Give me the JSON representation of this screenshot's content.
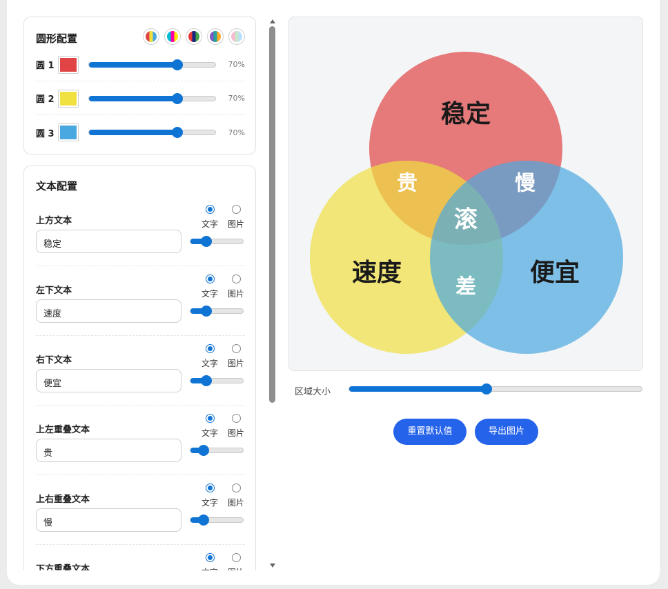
{
  "circle_config": {
    "title": "圆形配置",
    "presets": [
      {
        "name": "preset-1",
        "colors": [
          "#e04444",
          "#f0e040",
          "#4aa8e0"
        ]
      },
      {
        "name": "preset-2",
        "colors": [
          "#00bcd4",
          "#ff00aa",
          "#ffe600"
        ]
      },
      {
        "name": "preset-3",
        "colors": [
          "#e53935",
          "#1a237e",
          "#43a047"
        ]
      },
      {
        "name": "preset-4",
        "colors": [
          "#7e57c2",
          "#26a69a",
          "#ffa726"
        ]
      },
      {
        "name": "preset-5",
        "colors": [
          "#f8bbd0",
          "#c8e6c9",
          "#bbdefb"
        ]
      }
    ],
    "circles": [
      {
        "label": "圆 1",
        "color": "#e04444",
        "opacity": 0.7,
        "opacity_text": "70%"
      },
      {
        "label": "圆 2",
        "color": "#f0e040",
        "opacity": 0.7,
        "opacity_text": "70%"
      },
      {
        "label": "圆 3",
        "color": "#4aa8e0",
        "opacity": 0.7,
        "opacity_text": "70%"
      }
    ]
  },
  "text_config": {
    "title": "文本配置",
    "option_text": "文字",
    "option_image": "图片",
    "rows": [
      {
        "label": "上方文本",
        "value": "稳定",
        "mode": "text",
        "size_level": 0.3
      },
      {
        "label": "左下文本",
        "value": "速度",
        "mode": "text",
        "size_level": 0.3
      },
      {
        "label": "右下文本",
        "value": "便宜",
        "mode": "text",
        "size_level": 0.3
      },
      {
        "label": "上左重叠文本",
        "value": "贵",
        "mode": "text",
        "size_level": 0.25
      },
      {
        "label": "上右重叠文本",
        "value": "慢",
        "mode": "text",
        "size_level": 0.25
      },
      {
        "label": "下方重叠文本",
        "value": "差",
        "mode": "text",
        "size_level": 0.25
      }
    ]
  },
  "venn": {
    "top": "稳定",
    "left": "速度",
    "right": "便宜",
    "top_left": "贵",
    "top_right": "慢",
    "bottom": "差",
    "center": "滚"
  },
  "area_size": {
    "label": "区域大小",
    "level": 0.47
  },
  "buttons": {
    "reset": "重置默认值",
    "export": "导出图片"
  },
  "scroll": {
    "position": 0
  }
}
